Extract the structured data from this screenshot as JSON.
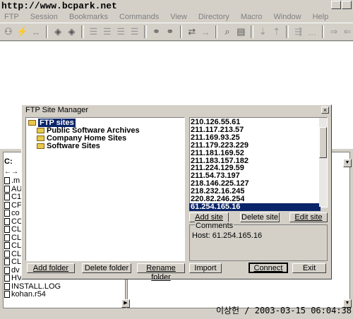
{
  "watermark": "http://www.bcpark.net",
  "menu": [
    "FTP",
    "Session",
    "Bookmarks",
    "Commands",
    "View",
    "Directory",
    "Macro",
    "Window",
    "Help"
  ],
  "toolbar_icons": [
    "connect-icon",
    "quick-connect-icon",
    "disconnect-icon",
    "site-manager-icon",
    "bookmark-icon",
    "list-icon",
    "binoculars-icon",
    "binoculars-icon",
    "transfer-icon",
    "arrow-icon",
    "search-icon",
    "doc-icon",
    "sort-down-icon",
    "sort-up-icon",
    "rename-icon",
    "more-icon",
    "move-right-icon",
    "move-left-icon"
  ],
  "local_panel": {
    "path": "C:",
    "nav": "←→",
    "files": [
      ".m",
      "AU",
      "C1",
      "CF",
      "co",
      "CC",
      "CL",
      "CL",
      "CL",
      "CL",
      "CL",
      "dv",
      "HV",
      "INSTALL.LOG",
      "kohan.r54"
    ]
  },
  "dialog": {
    "title": "FTP Site Manager",
    "close": "×",
    "tree": {
      "root": "FTP sites",
      "folders": [
        "Public Software Archives",
        "Company Home Sites",
        "Software Sites"
      ]
    },
    "sites": [
      "210.126.55.61",
      "211.117.213.57",
      "211.169.93.25",
      "211.179.223.229",
      "211.181.169.52",
      "211.183.157.182",
      "211.224.129.59",
      "211.54.73.197",
      "218.146.225.127",
      "218.232.16.245",
      "220.82.246.254",
      "61.254.165.16"
    ],
    "selected_site_index": 11,
    "buttons": {
      "add_site": "Add site",
      "delete_site": "Delete site",
      "edit_site": "Edit site",
      "add_folder": "Add folder",
      "delete_folder": "Delete folder",
      "rename_folder": "Rename folder",
      "import": "Import",
      "connect": "Connect",
      "exit": "Exit"
    },
    "comments_label": "Comments",
    "host": "Host: 61.254.165.16"
  },
  "signature": "이상헌 / 2003-03-15 06:04:38"
}
